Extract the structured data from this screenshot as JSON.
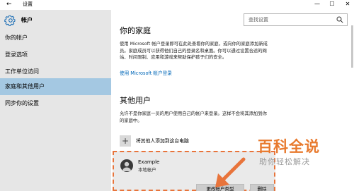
{
  "window": {
    "back_glyph": "←",
    "title": "设置",
    "controls": [
      "—",
      "☐",
      "✕"
    ]
  },
  "sidebar": {
    "header_label": "帐户",
    "items": [
      {
        "label": "你的帐户",
        "active": false
      },
      {
        "label": "登录选项",
        "active": false
      },
      {
        "label": "工作单位访问",
        "active": false
      },
      {
        "label": "家庭和其他用户",
        "active": true
      },
      {
        "label": "同步你的设置",
        "active": false
      }
    ]
  },
  "search": {
    "placeholder": "查找设置"
  },
  "family": {
    "heading": "你的家庭",
    "description": "使用 Microsoft 帐户登录即可在此处查看你的家庭，或向你的家庭添加新成员。家庭成员可以获得他们自己的登录名和桌面。你可以通过设置合适的网站、时间限制、应用和游戏来帮助保护孩子们的安全。",
    "link": "使用 Microsoft 帐户登录"
  },
  "other_users": {
    "heading": "其他用户",
    "description": "允许不是你家庭一员的用户使用自己的帐户来登录。这样不会将其添加到你的家庭中。",
    "add_label": "将其他人添加到这台电脑",
    "add_glyph": "+"
  },
  "account": {
    "name": "Example",
    "type": "本地帐户",
    "change_type_button": "更改帐户类型",
    "delete_button": "删除"
  },
  "watermark": {
    "brand": "百科全说",
    "slogan": "助你轻松解决"
  },
  "colors": {
    "accent": "#0067b8",
    "sidebar_bg": "#e6e6e6",
    "active_item": "#a4c8e2",
    "highlight": "#e8743b"
  }
}
